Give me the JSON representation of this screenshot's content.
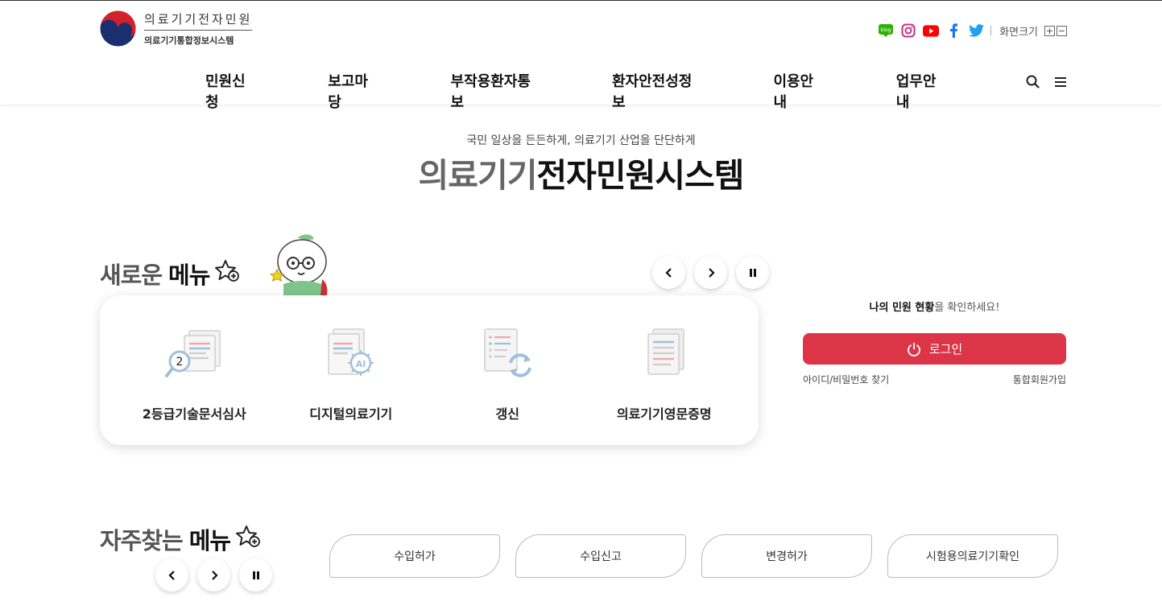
{
  "header": {
    "logo_line1": "의료기기전자민원",
    "logo_line2": "의료기기통합정보시스템",
    "sns": [
      "blog-icon",
      "instagram-icon",
      "youtube-icon",
      "facebook-icon",
      "twitter-icon"
    ],
    "fontsize_label": "화면크기",
    "fontsize_plus": "+",
    "fontsize_minus": "−"
  },
  "nav": {
    "items": [
      {
        "label": "민원신청"
      },
      {
        "label": "보고마당"
      },
      {
        "label": "부작용환자통보"
      },
      {
        "label": "환자안전성정보"
      },
      {
        "label": "이용안내"
      },
      {
        "label": "업무안내"
      }
    ]
  },
  "hero": {
    "subtitle": "국민 일상을 든든하게, 의료기기 산업을 단단하게",
    "title_gray": "의료기기",
    "title_dark": "전자민원시스템"
  },
  "new_menu": {
    "title_gray": "새로운",
    "title_dark": "메뉴",
    "items": [
      {
        "label": "2등급기술문서심사",
        "badge": "2"
      },
      {
        "label": "디지털의료기기",
        "badge": "AI"
      },
      {
        "label": "갱신"
      },
      {
        "label": "의료기기영문증명"
      }
    ]
  },
  "login_panel": {
    "status_bold": "나의 민원 현황",
    "status_rest": "을 확인하세요!",
    "login_label": "로그인",
    "find_label": "아이디/비밀번호 찾기",
    "join_label": "통합회원가입"
  },
  "frequent_menu": {
    "title_gray": "자주찾는",
    "title_dark": "메뉴",
    "items": [
      {
        "label": "수입허가"
      },
      {
        "label": "수입신고"
      },
      {
        "label": "변경허가"
      },
      {
        "label": "시험용의료기기확인"
      }
    ]
  },
  "colors": {
    "accent_red": "#dc3547",
    "nav_text": "#111111"
  }
}
